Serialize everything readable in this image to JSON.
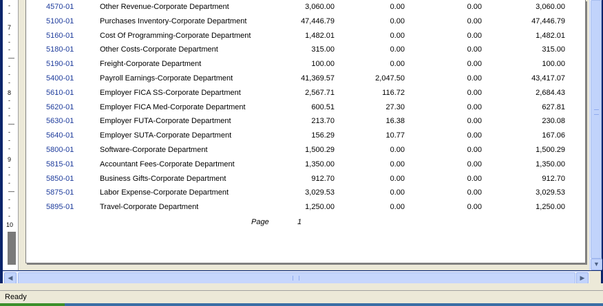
{
  "report": {
    "rows": [
      {
        "account": "4570-01",
        "description": "Other Revenue-Corporate Department",
        "c1": "3,060.00",
        "c2": "0.00",
        "c3": "0.00",
        "c4": "3,060.00"
      },
      {
        "account": "5100-01",
        "description": "Purchases Inventory-Corporate Department",
        "c1": "47,446.79",
        "c2": "0.00",
        "c3": "0.00",
        "c4": "47,446.79"
      },
      {
        "account": "5160-01",
        "description": "Cost Of Programming-Corporate Department",
        "c1": "1,482.01",
        "c2": "0.00",
        "c3": "0.00",
        "c4": "1,482.01"
      },
      {
        "account": "5180-01",
        "description": "Other Costs-Corporate Department",
        "c1": "315.00",
        "c2": "0.00",
        "c3": "0.00",
        "c4": "315.00"
      },
      {
        "account": "5190-01",
        "description": "Freight-Corporate Department",
        "c1": "100.00",
        "c2": "0.00",
        "c3": "0.00",
        "c4": "100.00"
      },
      {
        "account": "5400-01",
        "description": "Payroll Earnings-Corporate Department",
        "c1": "41,369.57",
        "c2": "2,047.50",
        "c3": "0.00",
        "c4": "43,417.07"
      },
      {
        "account": "5610-01",
        "description": "Employer FICA SS-Corporate Department",
        "c1": "2,567.71",
        "c2": "116.72",
        "c3": "0.00",
        "c4": "2,684.43"
      },
      {
        "account": "5620-01",
        "description": "Employer FICA Med-Corporate Department",
        "c1": "600.51",
        "c2": "27.30",
        "c3": "0.00",
        "c4": "627.81"
      },
      {
        "account": "5630-01",
        "description": "Employer FUTA-Corporate Department",
        "c1": "213.70",
        "c2": "16.38",
        "c3": "0.00",
        "c4": "230.08"
      },
      {
        "account": "5640-01",
        "description": "Employer SUTA-Corporate Department",
        "c1": "156.29",
        "c2": "10.77",
        "c3": "0.00",
        "c4": "167.06"
      },
      {
        "account": "5800-01",
        "description": "Software-Corporate Department",
        "c1": "1,500.29",
        "c2": "0.00",
        "c3": "0.00",
        "c4": "1,500.29"
      },
      {
        "account": "5815-01",
        "description": "Accountant Fees-Corporate Department",
        "c1": "1,350.00",
        "c2": "0.00",
        "c3": "0.00",
        "c4": "1,350.00"
      },
      {
        "account": "5850-01",
        "description": "Business Gifts-Corporate Department",
        "c1": "912.70",
        "c2": "0.00",
        "c3": "0.00",
        "c4": "912.70"
      },
      {
        "account": "5875-01",
        "description": "Labor Expense-Corporate Department",
        "c1": "3,029.53",
        "c2": "0.00",
        "c3": "0.00",
        "c4": "3,029.53"
      },
      {
        "account": "5895-01",
        "description": "Travel-Corporate Department",
        "c1": "1,250.00",
        "c2": "0.00",
        "c3": "0.00",
        "c4": "1,250.00"
      }
    ],
    "page_label": "Page",
    "page_number": "1"
  },
  "ruler": {
    "labels": [
      "7",
      "8",
      "9",
      "10"
    ]
  },
  "status": {
    "text": "Ready"
  },
  "icons": {
    "scroll_down": "triangle-down",
    "scroll_left": "triangle-left",
    "scroll_right": "triangle-right"
  }
}
